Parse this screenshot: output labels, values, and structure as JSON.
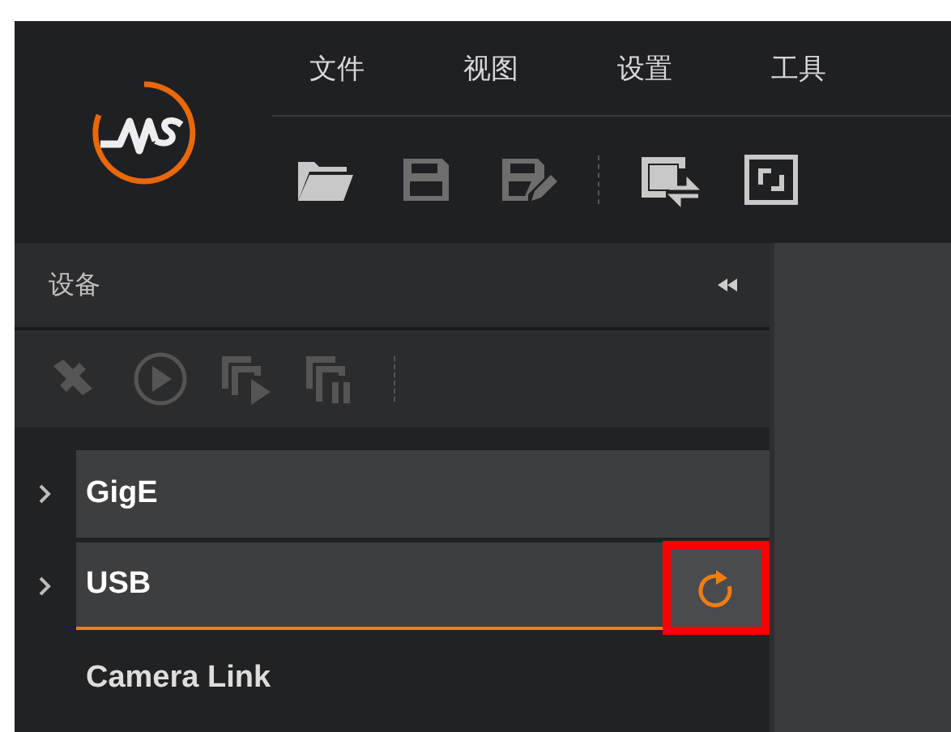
{
  "menu": [
    {
      "label": "文件"
    },
    {
      "label": "视图"
    },
    {
      "label": "设置"
    },
    {
      "label": "工具"
    }
  ],
  "toolbar": [
    {
      "kind": "open",
      "disabled": false
    },
    {
      "kind": "save",
      "disabled": true
    },
    {
      "kind": "save-as",
      "disabled": true
    },
    {
      "kind": "separator"
    },
    {
      "kind": "switch",
      "disabled": false
    },
    {
      "kind": "fullscreen",
      "disabled": false
    }
  ],
  "device_panel": {
    "title": "设备",
    "toolbar": [
      {
        "kind": "disconnect"
      },
      {
        "kind": "play"
      },
      {
        "kind": "grab"
      },
      {
        "kind": "stop-grab"
      },
      {
        "kind": "separator"
      }
    ],
    "items": [
      {
        "label": "GigE",
        "expandable": true,
        "expanded": false,
        "selected": false
      },
      {
        "label": "USB",
        "expandable": true,
        "expanded": false,
        "selected": true,
        "refresh_highlighted": true
      },
      {
        "label": "Camera Link",
        "expandable": false,
        "selected": false
      }
    ]
  }
}
